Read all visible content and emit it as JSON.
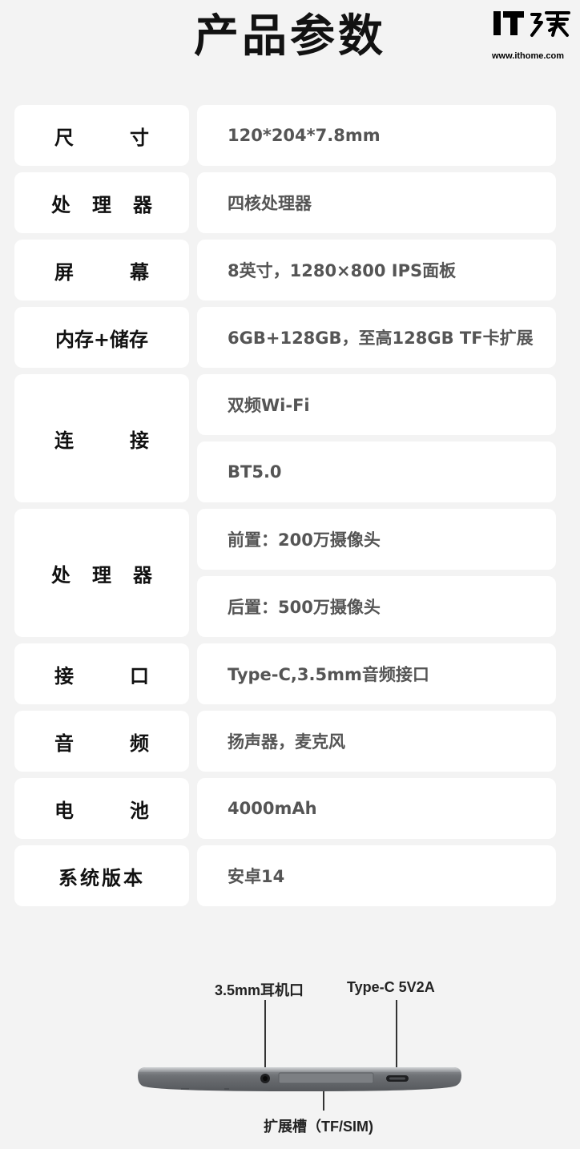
{
  "page": {
    "title": "产品参数",
    "logo_text": "IT之家",
    "logo_url": "www.ithome.com"
  },
  "specs": [
    {
      "label": "尺寸",
      "values": [
        "120*204*7.8mm"
      ]
    },
    {
      "label": "处理器",
      "values": [
        "四核处理器"
      ]
    },
    {
      "label": "屏幕",
      "values": [
        "8英寸，1280×800 IPS面板"
      ]
    },
    {
      "label": "内存+储存",
      "values": [
        "6GB+128GB，至高128GB TF卡扩展"
      ]
    },
    {
      "label": "连接",
      "values": [
        "双频Wi-Fi",
        "BT5.0"
      ]
    },
    {
      "label": "处理器",
      "values": [
        "前置：200万摄像头",
        "后置：500万摄像头"
      ]
    },
    {
      "label": "接口",
      "values": [
        "Type-C,3.5mm音频接口"
      ]
    },
    {
      "label": "音频",
      "values": [
        "扬声器，麦克风"
      ]
    },
    {
      "label": "电池",
      "values": [
        "4000mAh"
      ]
    },
    {
      "label": "系统版本",
      "values": [
        "安卓14"
      ]
    }
  ],
  "diagram": {
    "callouts": {
      "headphone": "3.5mm耳机口",
      "typec": "Type-C 5V2A",
      "slot": "扩展槽（TF/SIM)"
    }
  }
}
